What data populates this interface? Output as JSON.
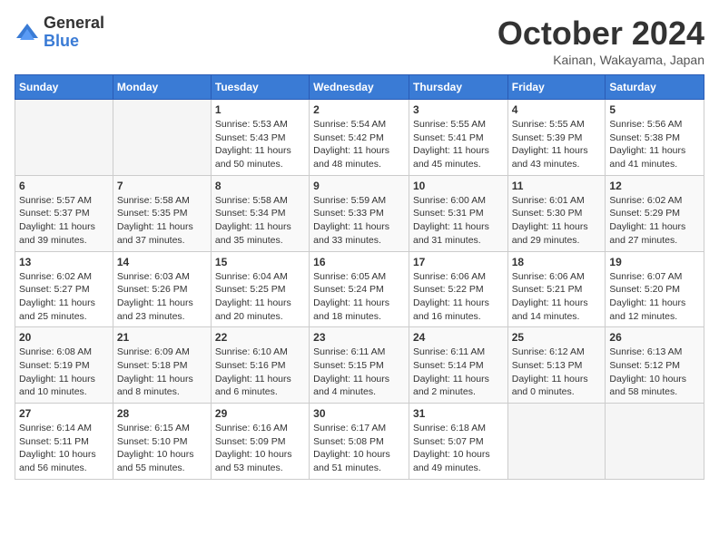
{
  "logo": {
    "general": "General",
    "blue": "Blue"
  },
  "title": "October 2024",
  "location": "Kainan, Wakayama, Japan",
  "weekdays": [
    "Sunday",
    "Monday",
    "Tuesday",
    "Wednesday",
    "Thursday",
    "Friday",
    "Saturday"
  ],
  "weeks": [
    [
      {
        "day": "",
        "info": ""
      },
      {
        "day": "",
        "info": ""
      },
      {
        "day": "1",
        "info": "Sunrise: 5:53 AM\nSunset: 5:43 PM\nDaylight: 11 hours and 50 minutes."
      },
      {
        "day": "2",
        "info": "Sunrise: 5:54 AM\nSunset: 5:42 PM\nDaylight: 11 hours and 48 minutes."
      },
      {
        "day": "3",
        "info": "Sunrise: 5:55 AM\nSunset: 5:41 PM\nDaylight: 11 hours and 45 minutes."
      },
      {
        "day": "4",
        "info": "Sunrise: 5:55 AM\nSunset: 5:39 PM\nDaylight: 11 hours and 43 minutes."
      },
      {
        "day": "5",
        "info": "Sunrise: 5:56 AM\nSunset: 5:38 PM\nDaylight: 11 hours and 41 minutes."
      }
    ],
    [
      {
        "day": "6",
        "info": "Sunrise: 5:57 AM\nSunset: 5:37 PM\nDaylight: 11 hours and 39 minutes."
      },
      {
        "day": "7",
        "info": "Sunrise: 5:58 AM\nSunset: 5:35 PM\nDaylight: 11 hours and 37 minutes."
      },
      {
        "day": "8",
        "info": "Sunrise: 5:58 AM\nSunset: 5:34 PM\nDaylight: 11 hours and 35 minutes."
      },
      {
        "day": "9",
        "info": "Sunrise: 5:59 AM\nSunset: 5:33 PM\nDaylight: 11 hours and 33 minutes."
      },
      {
        "day": "10",
        "info": "Sunrise: 6:00 AM\nSunset: 5:31 PM\nDaylight: 11 hours and 31 minutes."
      },
      {
        "day": "11",
        "info": "Sunrise: 6:01 AM\nSunset: 5:30 PM\nDaylight: 11 hours and 29 minutes."
      },
      {
        "day": "12",
        "info": "Sunrise: 6:02 AM\nSunset: 5:29 PM\nDaylight: 11 hours and 27 minutes."
      }
    ],
    [
      {
        "day": "13",
        "info": "Sunrise: 6:02 AM\nSunset: 5:27 PM\nDaylight: 11 hours and 25 minutes."
      },
      {
        "day": "14",
        "info": "Sunrise: 6:03 AM\nSunset: 5:26 PM\nDaylight: 11 hours and 23 minutes."
      },
      {
        "day": "15",
        "info": "Sunrise: 6:04 AM\nSunset: 5:25 PM\nDaylight: 11 hours and 20 minutes."
      },
      {
        "day": "16",
        "info": "Sunrise: 6:05 AM\nSunset: 5:24 PM\nDaylight: 11 hours and 18 minutes."
      },
      {
        "day": "17",
        "info": "Sunrise: 6:06 AM\nSunset: 5:22 PM\nDaylight: 11 hours and 16 minutes."
      },
      {
        "day": "18",
        "info": "Sunrise: 6:06 AM\nSunset: 5:21 PM\nDaylight: 11 hours and 14 minutes."
      },
      {
        "day": "19",
        "info": "Sunrise: 6:07 AM\nSunset: 5:20 PM\nDaylight: 11 hours and 12 minutes."
      }
    ],
    [
      {
        "day": "20",
        "info": "Sunrise: 6:08 AM\nSunset: 5:19 PM\nDaylight: 11 hours and 10 minutes."
      },
      {
        "day": "21",
        "info": "Sunrise: 6:09 AM\nSunset: 5:18 PM\nDaylight: 11 hours and 8 minutes."
      },
      {
        "day": "22",
        "info": "Sunrise: 6:10 AM\nSunset: 5:16 PM\nDaylight: 11 hours and 6 minutes."
      },
      {
        "day": "23",
        "info": "Sunrise: 6:11 AM\nSunset: 5:15 PM\nDaylight: 11 hours and 4 minutes."
      },
      {
        "day": "24",
        "info": "Sunrise: 6:11 AM\nSunset: 5:14 PM\nDaylight: 11 hours and 2 minutes."
      },
      {
        "day": "25",
        "info": "Sunrise: 6:12 AM\nSunset: 5:13 PM\nDaylight: 11 hours and 0 minutes."
      },
      {
        "day": "26",
        "info": "Sunrise: 6:13 AM\nSunset: 5:12 PM\nDaylight: 10 hours and 58 minutes."
      }
    ],
    [
      {
        "day": "27",
        "info": "Sunrise: 6:14 AM\nSunset: 5:11 PM\nDaylight: 10 hours and 56 minutes."
      },
      {
        "day": "28",
        "info": "Sunrise: 6:15 AM\nSunset: 5:10 PM\nDaylight: 10 hours and 55 minutes."
      },
      {
        "day": "29",
        "info": "Sunrise: 6:16 AM\nSunset: 5:09 PM\nDaylight: 10 hours and 53 minutes."
      },
      {
        "day": "30",
        "info": "Sunrise: 6:17 AM\nSunset: 5:08 PM\nDaylight: 10 hours and 51 minutes."
      },
      {
        "day": "31",
        "info": "Sunrise: 6:18 AM\nSunset: 5:07 PM\nDaylight: 10 hours and 49 minutes."
      },
      {
        "day": "",
        "info": ""
      },
      {
        "day": "",
        "info": ""
      }
    ]
  ]
}
